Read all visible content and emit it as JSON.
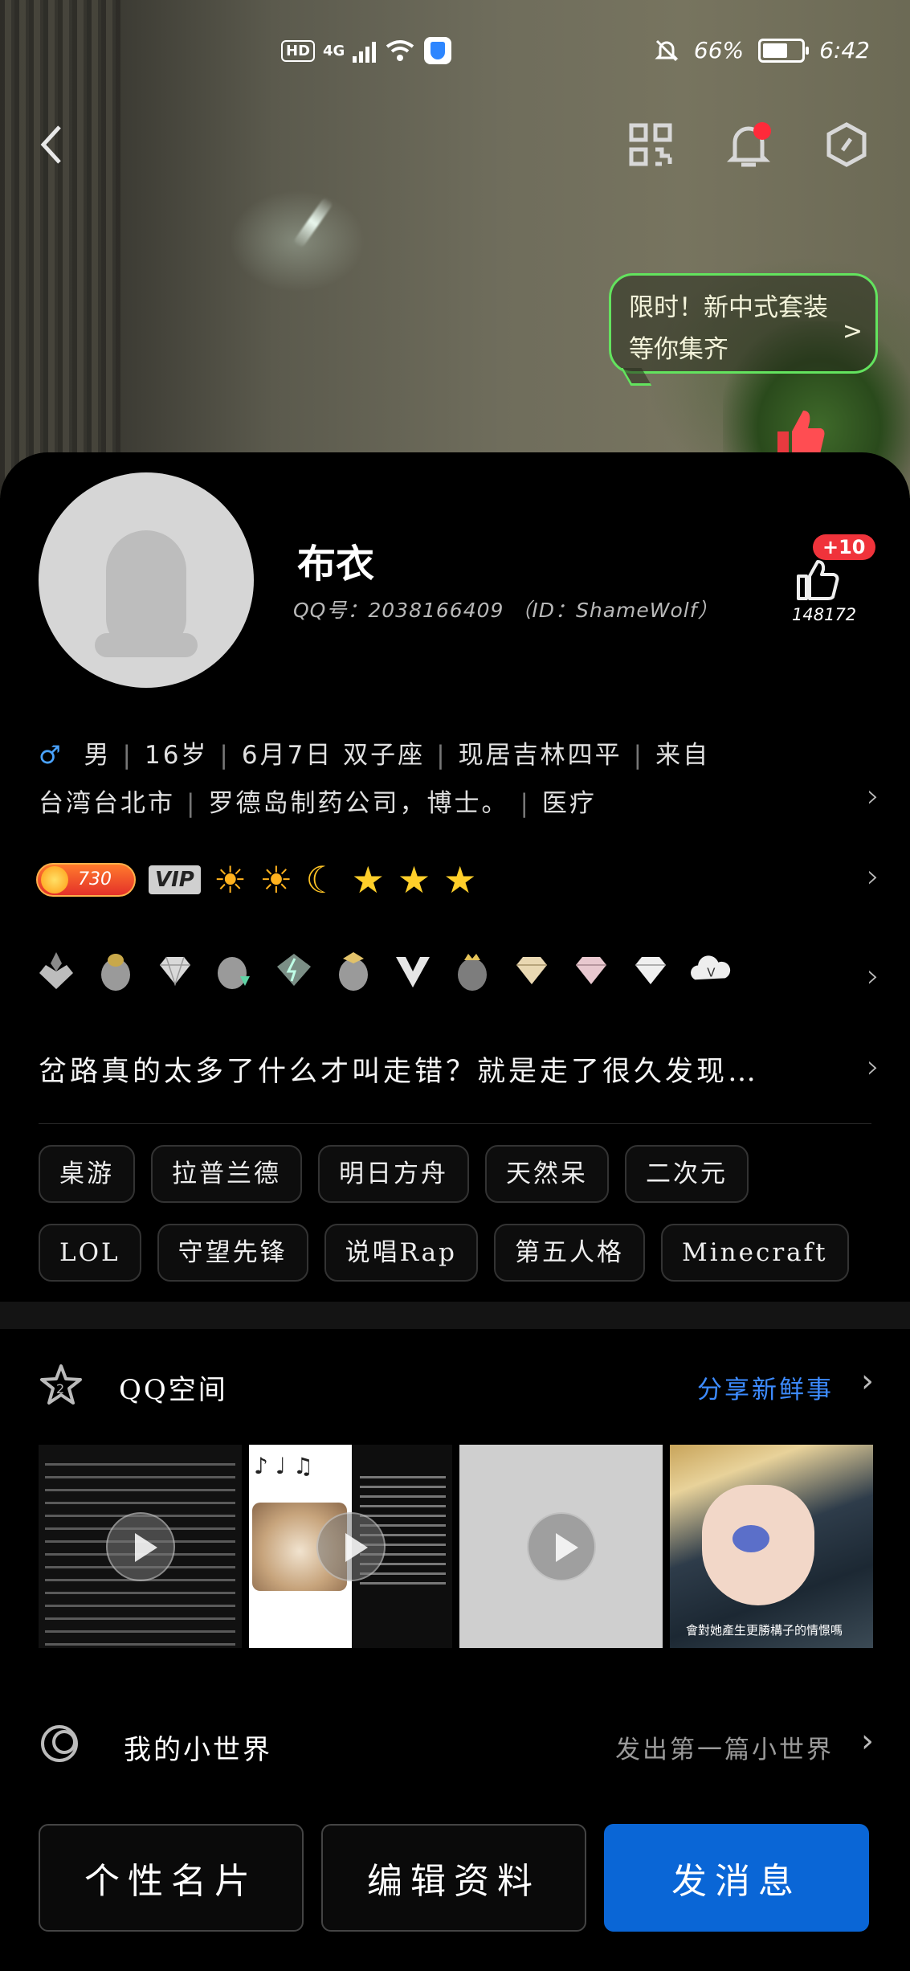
{
  "status_bar": {
    "hd": "HD",
    "network": "4G",
    "dnd_icon": "bell-slash-icon",
    "battery": "66%",
    "battery_level": 0.66,
    "time": "6:42"
  },
  "toolbar": {
    "back_icon": "chevron-left-icon",
    "qr_icon": "qr-code-icon",
    "notify_icon": "bell-icon",
    "settings_icon": "hexagon-settings-icon"
  },
  "promo": {
    "line1": "限时！新中式套装",
    "line2": "等你集齐"
  },
  "profile": {
    "nickname": "布衣",
    "qq_line": "QQ号：2038166409 （ID：ShameWolf）",
    "likes_plus": "+10",
    "likes_count": "148172",
    "gender_symbol": "♂",
    "info_line1": [
      "男",
      "16岁",
      "6月7日  双子座",
      "现居吉林四平",
      "来自"
    ],
    "info_line2": [
      "台湾台北市",
      "罗德岛制药公司，博士。",
      "医疗"
    ],
    "coin_value": "730",
    "vip_label": "VIP",
    "level_icons": [
      "☀",
      "☀",
      "☾",
      "★",
      "★",
      "★"
    ],
    "signature": "岔路真的太多了什么才叫走错？就是走了很久发现…"
  },
  "tags": {
    "row1": [
      "桌游",
      "拉普兰德",
      "明日方舟",
      "天然呆",
      "二次元"
    ],
    "row2": [
      "LOL",
      "守望先锋",
      "说唱Rap",
      "第五人格",
      "Minecraft"
    ]
  },
  "qzone": {
    "title": "QQ空间",
    "action": "分享新鲜事",
    "thumb4_caption": "會對她產生更勝構子的情憬嗎"
  },
  "world": {
    "title": "我的小世界",
    "action": "发出第一篇小世界"
  },
  "buttons": {
    "card": "个性名片",
    "edit": "编辑资料",
    "message": "发消息"
  },
  "colors": {
    "accent_blue": "#0A66D6",
    "link_blue": "#3D8BFF",
    "promo_green": "#63E35E",
    "badge_red": "#F0333B"
  }
}
